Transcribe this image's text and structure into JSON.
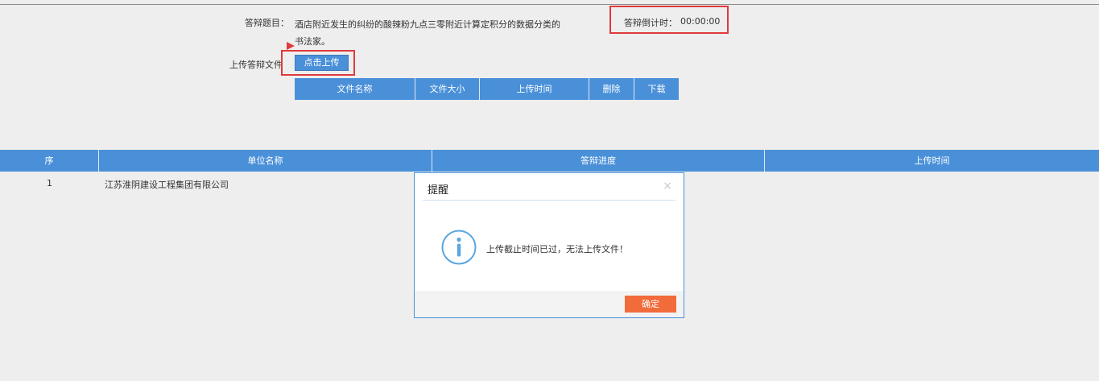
{
  "form": {
    "topic_label": "答辩题目：",
    "topic_line1": "酒店附近发生的纠纷的酸辣粉九点三零附近计算定积分的数据分类的",
    "topic_line2": "书法家。",
    "countdown_label": "答辩倒计时：",
    "countdown_value": "00:00:00",
    "upload_label": "上传答辩文件",
    "upload_button": "点击上传"
  },
  "file_table": {
    "columns": [
      "文件名称",
      "文件大小",
      "上传时间",
      "删除",
      "下载"
    ]
  },
  "main_table": {
    "columns": [
      "序",
      "单位名称",
      "答辩进度",
      "上传时间"
    ],
    "rows": [
      {
        "seq": "1",
        "unit": "江苏淮阴建设工程集团有限公司"
      }
    ]
  },
  "dialog": {
    "title": "提醒",
    "close": "×",
    "message": "上传截止时间已过，无法上传文件！",
    "ok": "确定",
    "icon": "info-icon"
  },
  "colors": {
    "header_blue": "#4a90d9",
    "highlight_red": "#e03a3a",
    "confirm_orange": "#f26b3a"
  }
}
